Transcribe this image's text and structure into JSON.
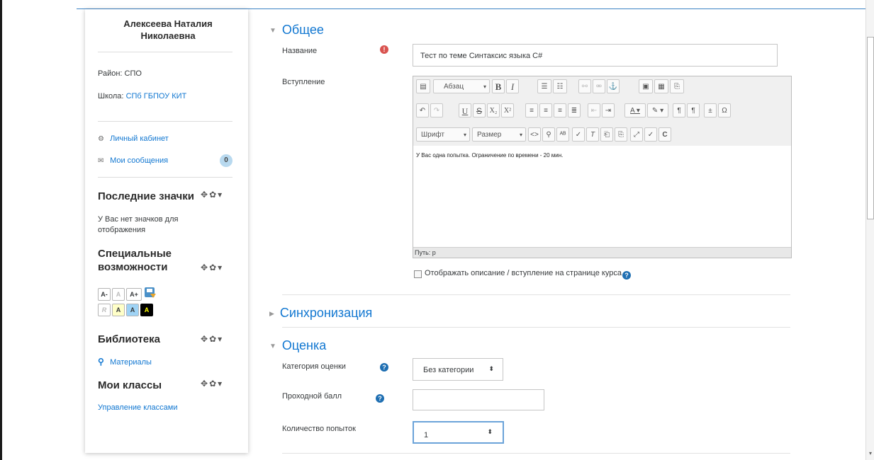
{
  "user": {
    "name": "Алексеева Наталия Николаевна"
  },
  "profile": {
    "district_label": "Район:",
    "district_value": "СПО",
    "school_label": "Школа:",
    "school_value": "СПб ГБПОУ КИТ"
  },
  "nav": {
    "cabinet": "Личный кабинет",
    "messages": "Мои сообщения",
    "messages_count": "0"
  },
  "blocks": {
    "badges": {
      "title": "Последние значки",
      "text": "У Вас нет значков для отображения"
    },
    "accessibility": {
      "title": "Специальные возможности",
      "buttons": [
        "A-",
        "A",
        "A+",
        "R",
        "A",
        "A",
        "A"
      ]
    },
    "library": {
      "title": "Библиотека",
      "link": "Материалы"
    },
    "classes": {
      "title": "Мои классы",
      "link": "Управление классами"
    }
  },
  "sections": {
    "general": "Общее",
    "sync": "Синхронизация",
    "grade": "Оценка"
  },
  "form": {
    "name_label": "Название",
    "name_value": "Тест по теме Синтаксис языка C#",
    "intro_label": "Вступление",
    "intro_text": "У Вас одна попытка. Ограничение по времени - 20 мин.",
    "path_label": "Путь: p",
    "show_desc_label": "Отображать описание / вступление на странице курса",
    "grade_category_label": "Категория оценки",
    "grade_category_value": "Без категории",
    "pass_grade_label": "Проходной балл",
    "pass_grade_value": "",
    "attempts_label": "Количество попыток",
    "attempts_value": "1"
  },
  "editor": {
    "format_select": "Абзац",
    "font_select": "Шрифт",
    "size_select": "Размер"
  },
  "colors": {
    "accent": "#1177d1",
    "required": "#d9534f",
    "help": "#1f6fb2"
  }
}
